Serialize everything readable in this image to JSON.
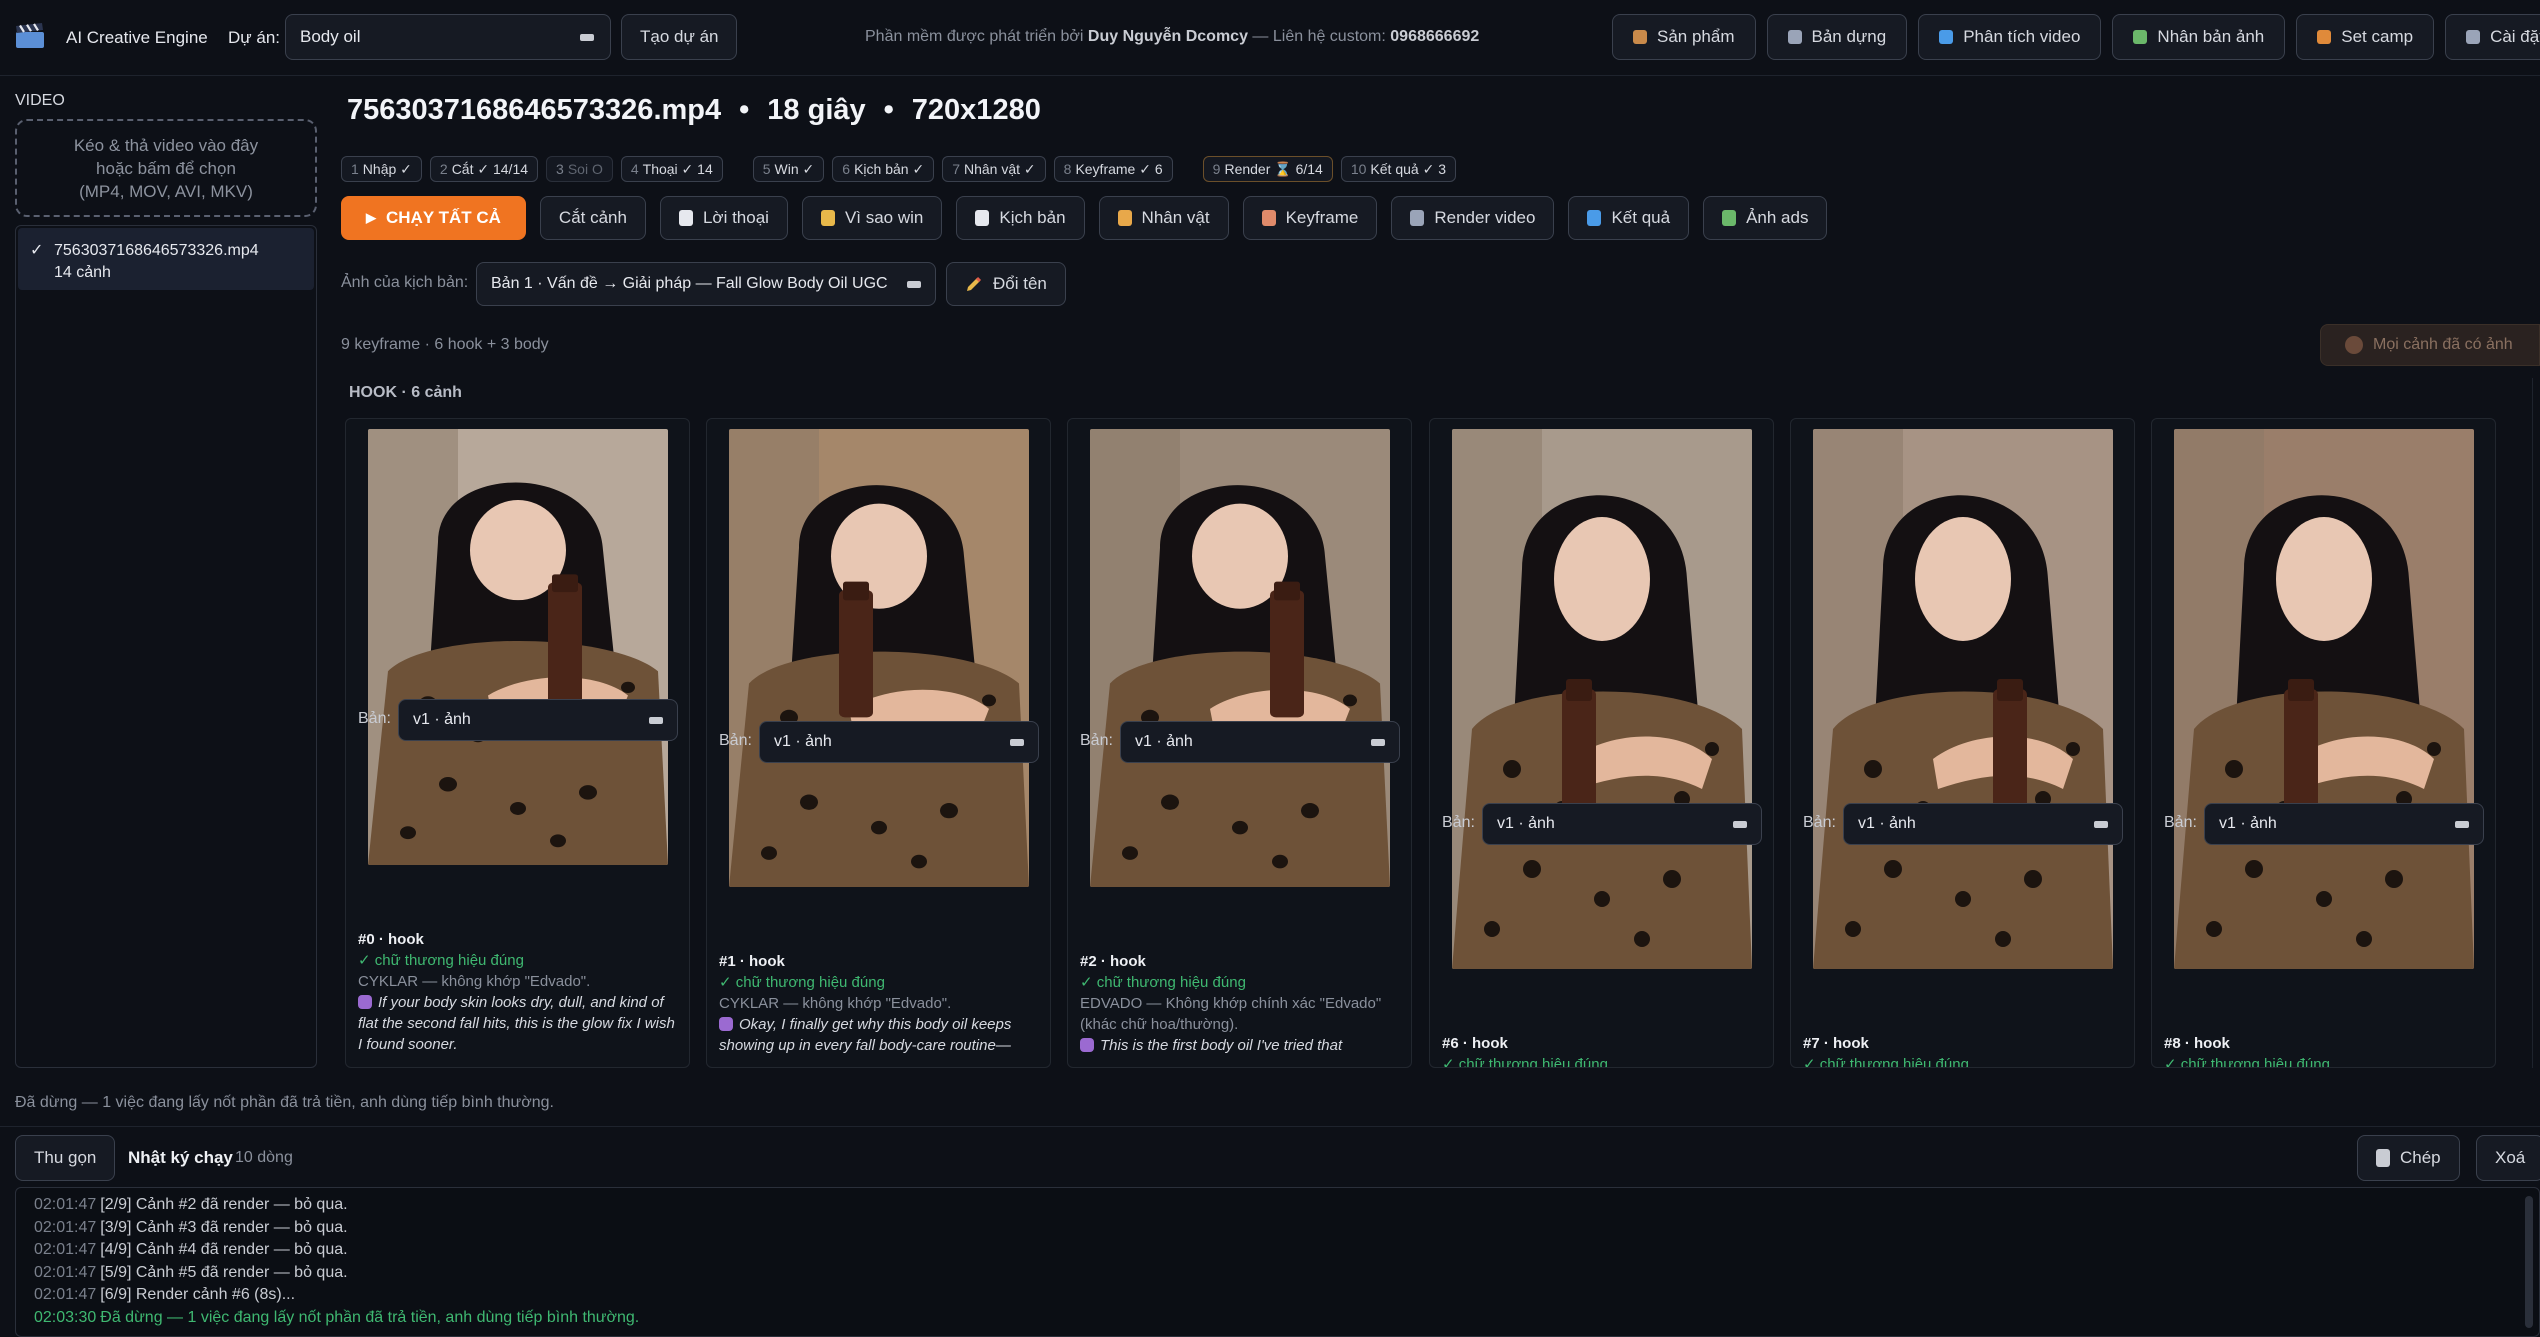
{
  "app": {
    "title": "AI Creative Engine"
  },
  "header": {
    "project_label": "Dự án:",
    "project_value": "Body oil",
    "create_project": "Tạo dự án",
    "credit_prefix": "Phần mềm được phát triển bởi",
    "credit_author": "Duy Nguyễn Dcomcy",
    "credit_mid": "— Liên hệ custom:",
    "credit_phone": "0968666692",
    "nav": [
      {
        "label": "Sản phẩm",
        "icon": "box-icon",
        "color": "#c98a4a"
      },
      {
        "label": "Bản dựng",
        "icon": "film-icon",
        "color": "#9aa4b8"
      },
      {
        "label": "Phân tích video",
        "icon": "magnifier-icon",
        "color": "#4a9be8"
      },
      {
        "label": "Nhân bản ảnh",
        "icon": "image-icon",
        "color": "#6bb86a"
      },
      {
        "label": "Set camp",
        "icon": "megaphone-icon",
        "color": "#e08a3a"
      },
      {
        "label": "Cài đặt",
        "icon": "gear-icon",
        "color": "#9aa4b8"
      }
    ]
  },
  "sidebar": {
    "section_label": "VIDEO",
    "dropzone": [
      "Kéo & thả video vào đây",
      "hoặc bấm để chọn",
      "(MP4, MOV, AVI, MKV)"
    ],
    "video_item": {
      "check": "✓",
      "name": "7563037168646573326.mp4",
      "scenes": "14 cảnh"
    }
  },
  "main": {
    "file_name": "7563037168646573326.mp4",
    "duration": "18 giây",
    "resolution": "720x1280",
    "dot": "•",
    "stages": [
      {
        "n": "1",
        "label": "Nhập ✓",
        "state": "done"
      },
      {
        "n": "2",
        "label": "Cắt ✓ 14/14",
        "state": "done"
      },
      {
        "n": "3",
        "label": "Soi O",
        "state": "dim"
      },
      {
        "n": "4",
        "label": "Thoại ✓ 14",
        "state": "done"
      },
      {
        "n": "5",
        "label": "Win ✓",
        "state": "done"
      },
      {
        "n": "6",
        "label": "Kịch bản ✓",
        "state": "done"
      },
      {
        "n": "7",
        "label": "Nhân vật ✓",
        "state": "done"
      },
      {
        "n": "8",
        "label": "Keyframe ✓ 6",
        "state": "done"
      },
      {
        "n": "9",
        "label": "Render ⌛ 6/14",
        "state": "active"
      },
      {
        "n": "10",
        "label": "Kết quả ✓ 3",
        "state": "done"
      }
    ],
    "run_all": "CHẠY TẤT CẢ",
    "actions": [
      {
        "label": "Cắt cảnh",
        "icon": "",
        "color": ""
      },
      {
        "label": "Lời thoại",
        "icon": "document-icon",
        "color": "#e6e8ee"
      },
      {
        "label": "Vì sao win",
        "icon": "trophy-icon",
        "color": "#e8b84a"
      },
      {
        "label": "Kịch bản",
        "icon": "script-icon",
        "color": "#e6e8ee"
      },
      {
        "label": "Nhân vật",
        "icon": "person-icon",
        "color": "#e8a84a"
      },
      {
        "label": "Keyframe",
        "icon": "palette-icon",
        "color": "#e08a6a"
      },
      {
        "label": "Render video",
        "icon": "clapper-icon",
        "color": "#9aa4b8"
      },
      {
        "label": "Kết quả",
        "icon": "film-strip-icon",
        "color": "#4a9be8"
      },
      {
        "label": "Ảnh ads",
        "icon": "picture-icon",
        "color": "#6bb86a"
      }
    ],
    "script_label": "Ảnh của kịch bản:",
    "script_value": "Bản 1 · Vấn đề → Giải pháp — Fall Glow Body Oil UGC",
    "rename": "Đổi tên",
    "keyframe_summary": "9 keyframe · 6 hook + 3 body",
    "all_have": "Mọi cảnh đã có ảnh",
    "hook_title": "HOOK",
    "hook_count": "6 cảnh",
    "ver_label": "Bản:",
    "cards": [
      {
        "id": "#0 · hook",
        "version": "v1 · ảnh",
        "brand": "✓ chữ thương hiệu đúng",
        "note": "CYKLAR — không khớp \"Edvado\".",
        "quote": "If your body skin looks dry, dull, and kind of flat the second fall hits, this is the glow fix I wish I found sooner."
      },
      {
        "id": "#1 · hook",
        "version": "v1 · ảnh",
        "brand": "✓ chữ thương hiệu đúng",
        "note": "CYKLAR — không khớp \"Edvado\".",
        "quote": "Okay, I finally get why this body oil keeps showing up in every fall body-care routine—"
      },
      {
        "id": "#2 · hook",
        "version": "v1 · ảnh",
        "brand": "✓ chữ thương hiệu đúng",
        "note": "EDVADO — Không khớp chính xác \"Edvado\" (khác chữ hoa/thường).",
        "quote": "This is the first body oil I've tried that"
      },
      {
        "id": "#6 · hook",
        "version": "v1 · ảnh",
        "brand": "✓ chữ thương hiệu đúng",
        "note": "",
        "quote": ""
      },
      {
        "id": "#7 · hook",
        "version": "v1 · ảnh",
        "brand": "✓ chữ thương hiệu đúng",
        "note": "",
        "quote": ""
      },
      {
        "id": "#8 · hook",
        "version": "v1 · ảnh",
        "brand": "✓ chữ thương hiệu đúng",
        "note": "",
        "quote": ""
      }
    ]
  },
  "status": "Đã dừng — 1 việc đang lấy nốt phần đã trả tiền, anh dùng tiếp bình thường.",
  "log": {
    "collapse": "Thu gọn",
    "title": "Nhật ký chạy",
    "count": "10 dòng",
    "copy": "Chép",
    "clear": "Xoá",
    "lines": [
      {
        "time": "02:01:47",
        "text": "[2/9] Cảnh #2 đã render — bỏ qua.",
        "tone": "normal"
      },
      {
        "time": "02:01:47",
        "text": "[3/9] Cảnh #3 đã render — bỏ qua.",
        "tone": "normal"
      },
      {
        "time": "02:01:47",
        "text": "[4/9] Cảnh #4 đã render — bỏ qua.",
        "tone": "normal"
      },
      {
        "time": "02:01:47",
        "text": "[5/9] Cảnh #5 đã render — bỏ qua.",
        "tone": "normal"
      },
      {
        "time": "02:01:47",
        "text": "[6/9] Render cảnh #6 (8s)...",
        "tone": "normal"
      },
      {
        "time": "02:03:30",
        "text": "Đã dừng — 1 việc đang lấy nốt phần đã trả tiền, anh dùng tiếp bình thường.",
        "tone": "green"
      }
    ]
  },
  "colors": {
    "accent": "#f07421",
    "ok": "#3fb871",
    "bg": "#0d1017"
  }
}
